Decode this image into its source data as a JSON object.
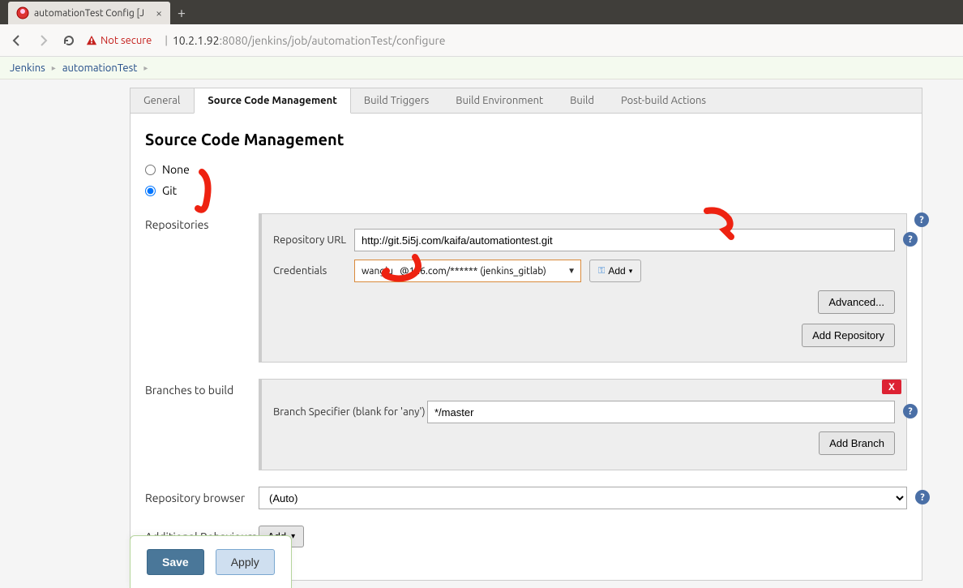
{
  "browser": {
    "tab_title": "automationTest Config [J",
    "not_secure": "Not secure",
    "url_host": "10.2.1.92",
    "url_port": ":8080",
    "url_path": "/jenkins/job/automationTest/configure"
  },
  "breadcrumb": {
    "root": "Jenkins",
    "job": "automationTest"
  },
  "tabs": {
    "general": "General",
    "scm": "Source Code Management",
    "triggers": "Build Triggers",
    "env": "Build Environment",
    "build": "Build",
    "post": "Post-build Actions"
  },
  "page": {
    "heading": "Source Code Management"
  },
  "scm": {
    "none": "None",
    "git": "Git"
  },
  "git": {
    "repositories_label": "Repositories",
    "repo_url_label": "Repository URL",
    "repo_url_value": "http://git.5i5j.com/kaifa/automationtest.git",
    "credentials_label": "Credentials",
    "credentials_value": "wangju   @126.com/****** (jenkins_gitlab)",
    "add_cred": "Add",
    "advanced": "Advanced...",
    "add_repo": "Add Repository",
    "branches_label": "Branches to build",
    "branch_spec_label": "Branch Specifier (blank for 'any')",
    "branch_spec_value": "*/master",
    "add_branch": "Add Branch",
    "delete_x": "X",
    "repo_browser_label": "Repository browser",
    "repo_browser_value": "(Auto)",
    "addl_behaviours_label": "Additional Behaviours",
    "add_behaviour": "Add"
  },
  "footer": {
    "save": "Save",
    "apply": "Apply"
  }
}
